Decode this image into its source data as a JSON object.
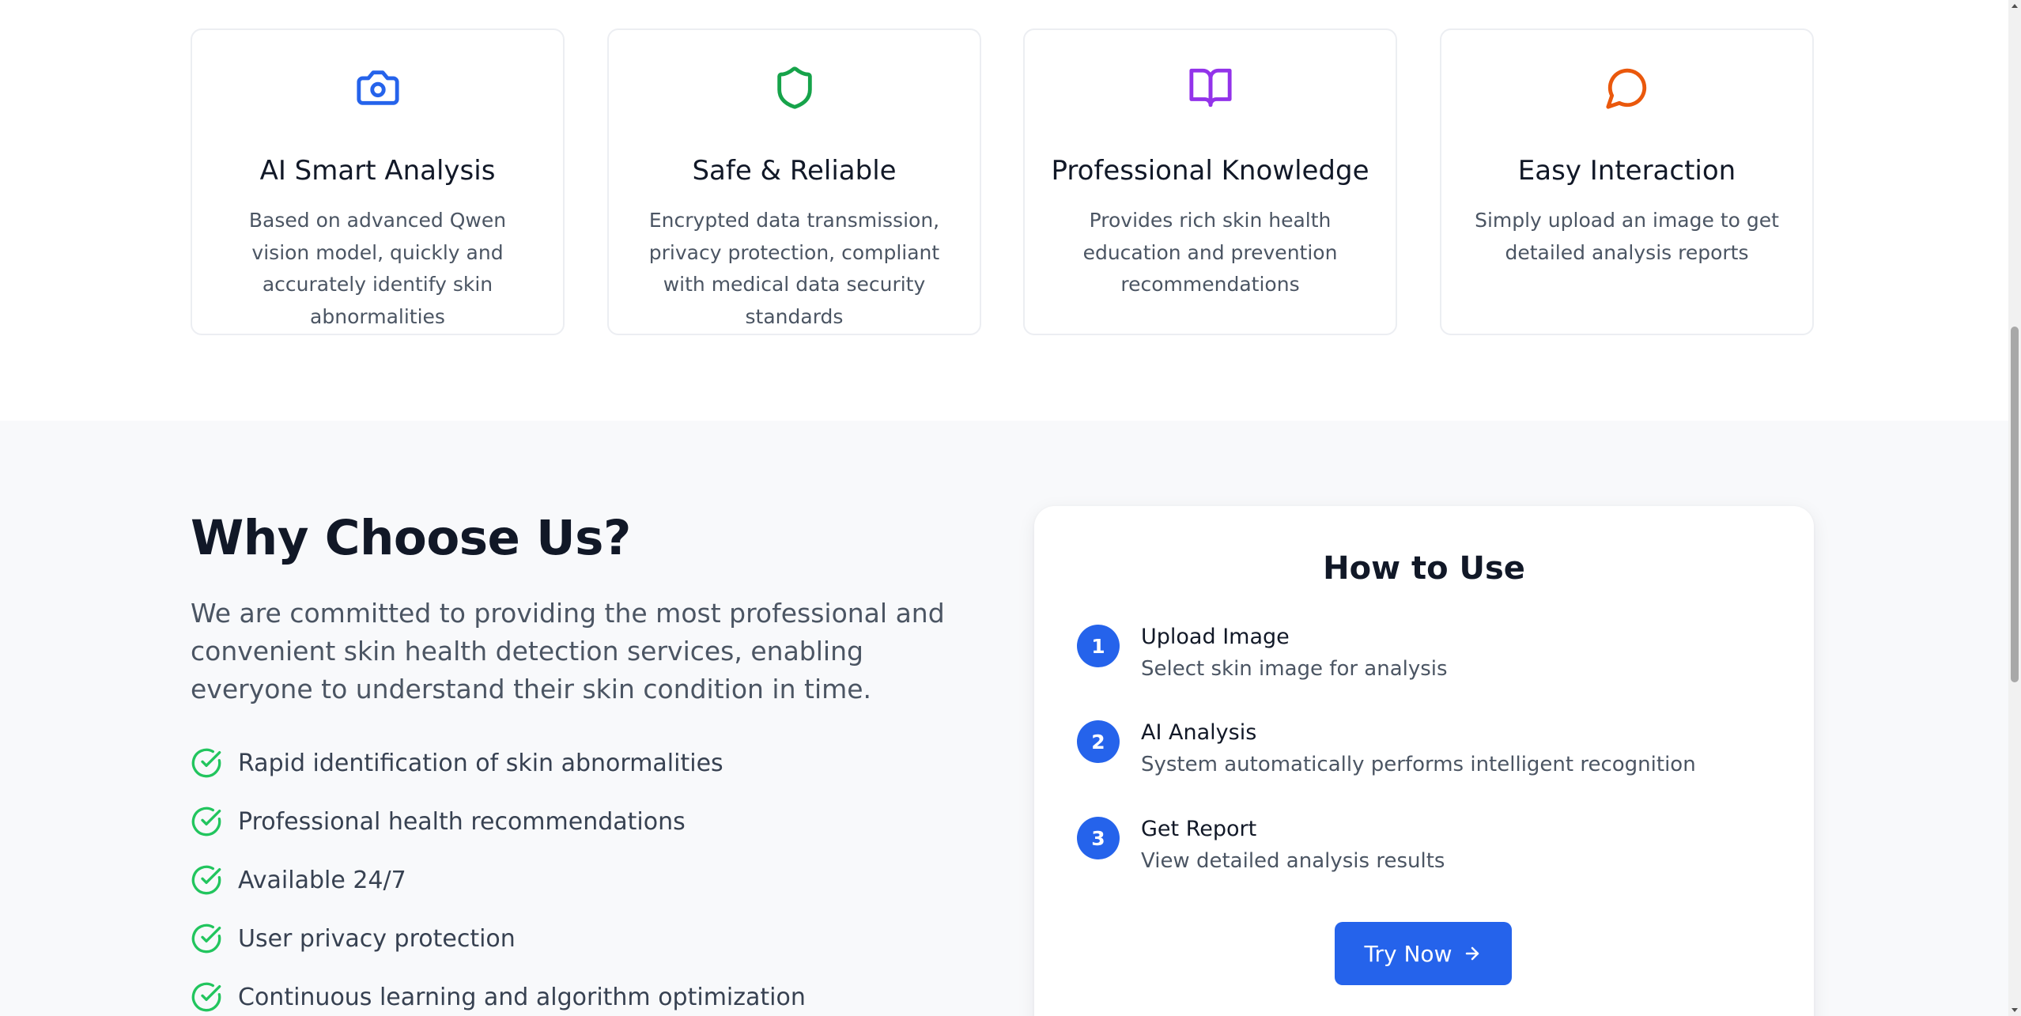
{
  "features": [
    {
      "icon": "camera-icon",
      "color": "#2563eb",
      "title": "AI Smart Analysis",
      "description": "Based on advanced Qwen vision model, quickly and accurately identify skin abnormalities"
    },
    {
      "icon": "shield-icon",
      "color": "#16a34a",
      "title": "Safe & Reliable",
      "description": "Encrypted data transmission, privacy protection, compliant with medical data security standards"
    },
    {
      "icon": "book-open-icon",
      "color": "#9333ea",
      "title": "Professional Knowledge",
      "description": "Provides rich skin health education and prevention recommendations"
    },
    {
      "icon": "message-circle-icon",
      "color": "#ea580c",
      "title": "Easy Interaction",
      "description": "Simply upload an image to get detailed analysis reports"
    }
  ],
  "why": {
    "title": "Why Choose Us?",
    "description": "We are committed to providing the most professional and convenient skin health detection services, enabling everyone to understand their skin condition in time.",
    "check_color": "#22c55e",
    "benefits": [
      "Rapid identification of skin abnormalities",
      "Professional health recommendations",
      "Available 24/7",
      "User privacy protection",
      "Continuous learning and algorithm optimization"
    ]
  },
  "how_to_use": {
    "title": "How to Use",
    "steps": [
      {
        "number": "1",
        "title": "Upload Image",
        "description": "Select skin image for analysis"
      },
      {
        "number": "2",
        "title": "AI Analysis",
        "description": "System automatically performs intelligent recognition"
      },
      {
        "number": "3",
        "title": "Get Report",
        "description": "View detailed analysis results"
      }
    ],
    "button_label": "Try Now",
    "button_icon": "arrow-right-icon",
    "accent_color": "#2563eb"
  }
}
